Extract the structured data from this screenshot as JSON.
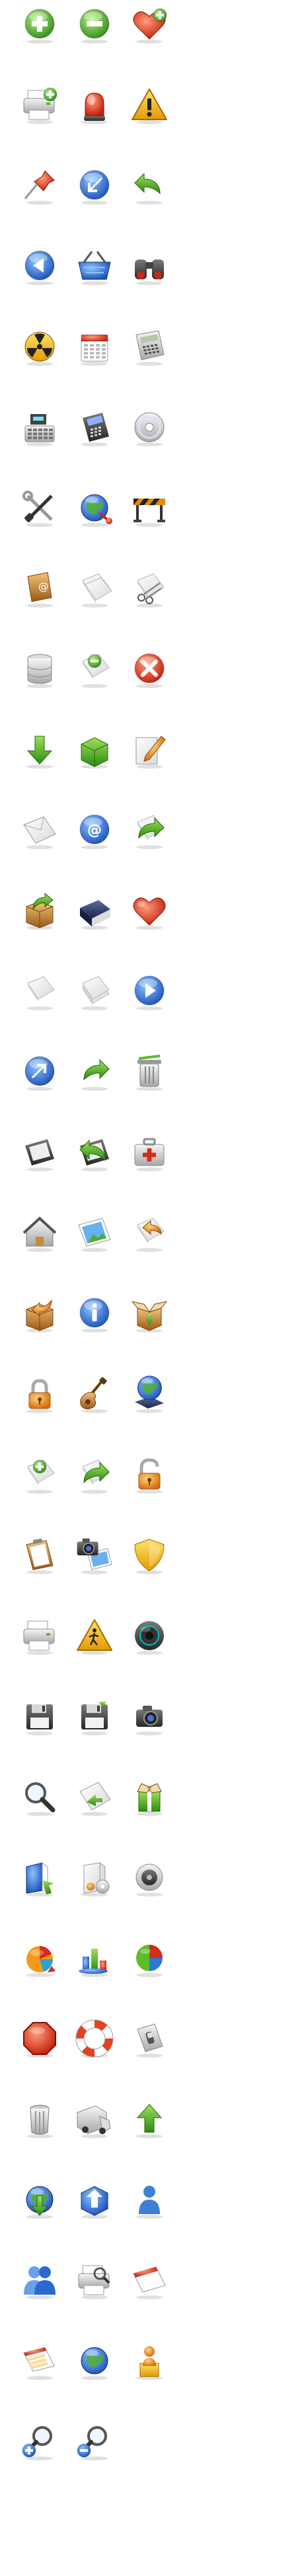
{
  "sheet": {
    "columns": 3,
    "icons": [
      [
        "add-icon",
        "remove-icon",
        "favorite-add-icon"
      ],
      [
        "printer-add-icon",
        "alarm-light-icon",
        "warning-icon"
      ],
      [
        "thumbtack-icon",
        "arrow-down-left-icon",
        "undo-arrow-icon"
      ],
      [
        "back-icon",
        "shopping-basket-icon",
        "binoculars-icon"
      ],
      [
        "radiation-icon",
        "calendar-icon",
        "calculator-icon"
      ],
      [
        "cash-register-icon",
        "payment-terminal-icon",
        "cd-icon"
      ],
      [
        "tools-icon",
        "globe-network-icon",
        "construction-barrier-icon"
      ],
      [
        "address-book-icon",
        "copy-icon",
        "cut-icon"
      ],
      [
        "database-icon",
        "document-remove-icon",
        "delete-icon"
      ],
      [
        "download-icon",
        "package-icon",
        "edit-icon"
      ],
      [
        "email-icon",
        "email-at-icon",
        "document-export-icon"
      ],
      [
        "box-export-icon",
        "book-icon",
        "heart-icon"
      ],
      [
        "blank-document-icon",
        "document-stack-icon",
        "forward-icon"
      ],
      [
        "arrow-up-right-icon",
        "redo-arrow-icon",
        "trash-can-icon"
      ],
      [
        "device-icon",
        "device-return-icon",
        "first-aid-kit-icon"
      ],
      [
        "home-icon",
        "image-icon",
        "document-undo-icon"
      ],
      [
        "box-import-icon",
        "info-icon",
        "package-open-icon"
      ],
      [
        "padlock-icon",
        "guitar-icon",
        "globe-book-icon"
      ],
      [
        "document-add-icon",
        "document-redo-icon",
        "padlock-open-icon"
      ],
      [
        "clipboard-icon",
        "camera-photo-icon",
        "shield-icon"
      ],
      [
        "printer-icon",
        "pedestrian-sign-icon",
        "speaker-icon"
      ],
      [
        "floppy-disk-icon",
        "floppy-disk-save-icon",
        "camera-icon"
      ],
      [
        "search-icon",
        "document-arrow-icon",
        "gift-box-icon"
      ],
      [
        "software-box-download-icon",
        "software-box-cd-icon",
        "volume-icon"
      ],
      [
        "pie-chart-icon",
        "chart-bars-icon",
        "pie-chart-color-icon"
      ],
      [
        "stop-sign-icon",
        "lifebuoy-icon",
        "switch-icon"
      ],
      [
        "trash-bin-icon",
        "truck-icon",
        "arrow-up-icon"
      ],
      [
        "globe-download-icon",
        "cube-upload-icon",
        "user-icon"
      ],
      [
        "users-icon",
        "printer-scanner-icon",
        "calendar-empty-icon"
      ],
      [
        "calendar-rows-icon",
        "globe-icon",
        "user-builder-icon"
      ],
      [
        "zoom-in-icon",
        "zoom-out-icon"
      ]
    ]
  }
}
